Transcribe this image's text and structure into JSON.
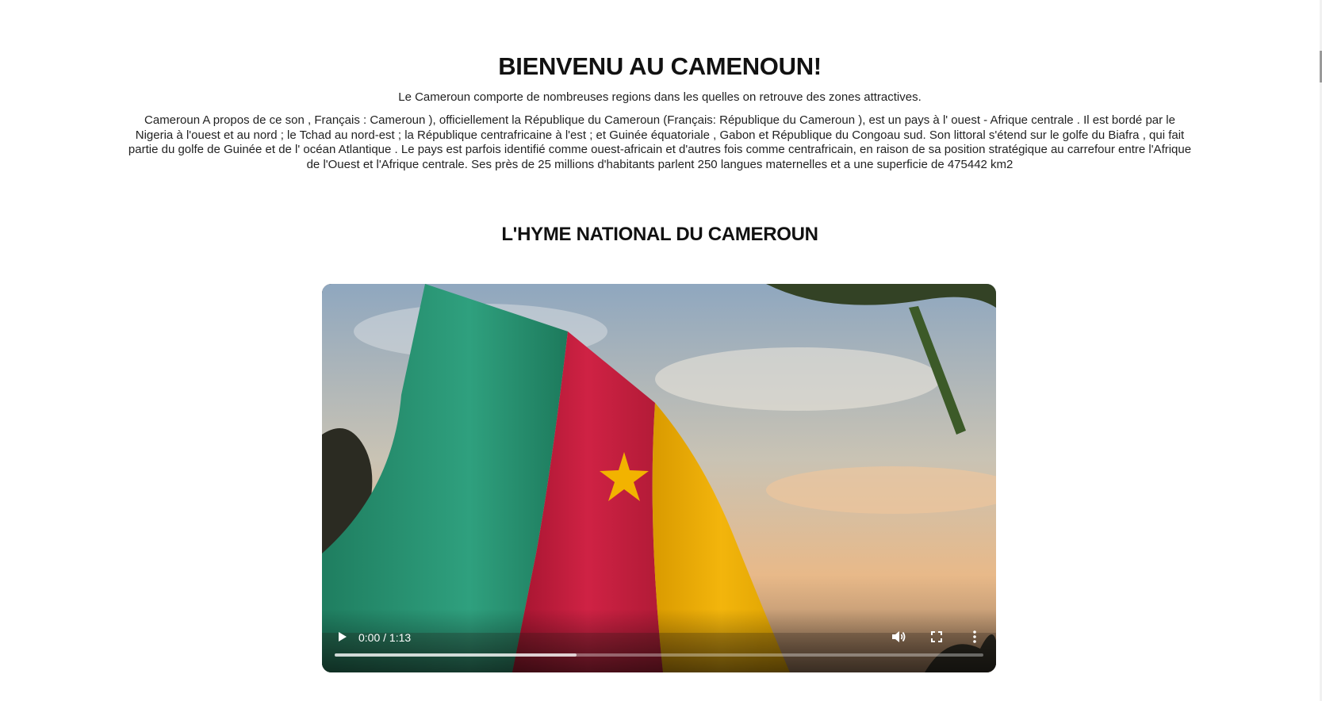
{
  "header": {
    "title": "BIENVENU AU CAMENOUN!",
    "intro": "Le Cameroun comporte de nombreuses regions dans les quelles on retrouve des zones attractives.",
    "body": "Cameroun A propos de ce son , Français : Cameroun ), officiellement la République du Cameroun (Français: République du Cameroun ), est un pays à l' ouest - Afrique centrale . Il est bordé par le Nigeria à l'ouest et au nord ; le Tchad au nord-est ; la République centrafricaine à l'est ; et Guinée équatoriale , Gabon et République du Congoau sud. Son littoral s'étend sur le golfe du Biafra , qui fait partie du golfe de Guinée et de l' océan Atlantique . Le pays est parfois identifié comme ouest-africain et d'autres fois comme centrafricain, en raison de sa position stratégique au carrefour entre l'Afrique de l'Ouest et l'Afrique centrale. Ses près de 25 millions d'habitants parlent 250 langues maternelles et a une superficie de 475442 km2"
  },
  "anthem": {
    "title": "L'HYME NATIONAL DU CAMEROUN"
  },
  "video": {
    "time_display": "0:00 / 1:13",
    "buffered_fraction": 0.373,
    "icons": {
      "play": "play-icon",
      "volume": "volume-icon",
      "fullscreen": "fullscreen-icon",
      "more": "more-options-icon"
    },
    "flag_colors": {
      "green": "#2a9a78",
      "red": "#c8203e",
      "yellow": "#f0b400"
    }
  }
}
